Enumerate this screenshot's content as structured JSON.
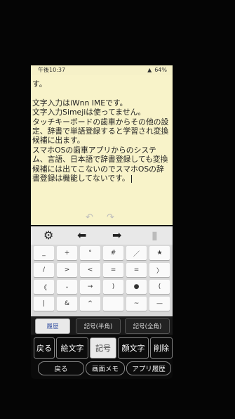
{
  "status": {
    "time": "午後10:37",
    "battery": "64%"
  },
  "note": {
    "text": "す。\n\n文字入力はiWnn IMEです。\n文字入力Simejiは使ってません。\nタッチキーボードの歯車からその他の設定、辞書で単語登録すると学習され変換候補に出ます。\nスマホOSの歯車アプリからのシステム、言語、日本語で辞書登録しても変換候補には出てこないのでスマホOSの辞書登録は機能してないです。"
  },
  "keyboard": {
    "keys": [
      "_",
      "+",
      "°",
      "#",
      "／",
      "★",
      "/",
      ">",
      "<",
      "=",
      "=",
      "〉",
      "《",
      "・",
      "→",
      ")",
      "●",
      "(",
      "|",
      "&",
      "^",
      "",
      "~",
      "—"
    ]
  },
  "tabs": [
    "履歴",
    "記号(半角)",
    "記号(全角)"
  ],
  "buttons": [
    "戻る",
    "絵文字",
    "記号",
    "顔文字",
    "削除"
  ],
  "nav": [
    "戻る",
    "画面メモ",
    "アプリ履歴"
  ],
  "colors": {
    "note_bg": "#f8f3c9",
    "tab_active_text": "#3a55a5"
  }
}
